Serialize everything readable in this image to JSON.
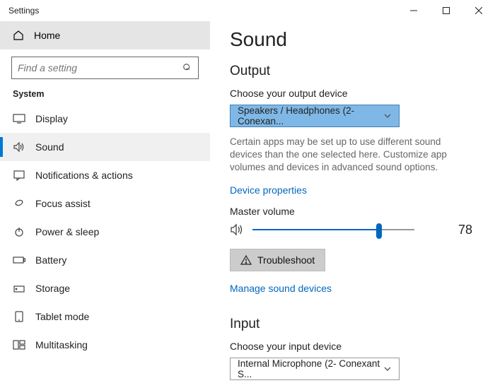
{
  "window": {
    "title": "Settings"
  },
  "sidebar": {
    "home": "Home",
    "search_placeholder": "Find a setting",
    "section": "System",
    "items": [
      {
        "label": "Display"
      },
      {
        "label": "Sound"
      },
      {
        "label": "Notifications & actions"
      },
      {
        "label": "Focus assist"
      },
      {
        "label": "Power & sleep"
      },
      {
        "label": "Battery"
      },
      {
        "label": "Storage"
      },
      {
        "label": "Tablet mode"
      },
      {
        "label": "Multitasking"
      }
    ]
  },
  "main": {
    "title": "Sound",
    "output": {
      "heading": "Output",
      "choose_label": "Choose your output device",
      "device": "Speakers / Headphones (2- Conexan...",
      "help": "Certain apps may be set up to use different sound devices than the one selected here. Customize app volumes and devices in advanced sound options.",
      "device_properties": "Device properties",
      "master_label": "Master volume",
      "volume": 78,
      "troubleshoot": "Troubleshoot",
      "manage": "Manage sound devices"
    },
    "input": {
      "heading": "Input",
      "choose_label": "Choose your input device",
      "device": "Internal Microphone (2- Conexant S..."
    }
  }
}
